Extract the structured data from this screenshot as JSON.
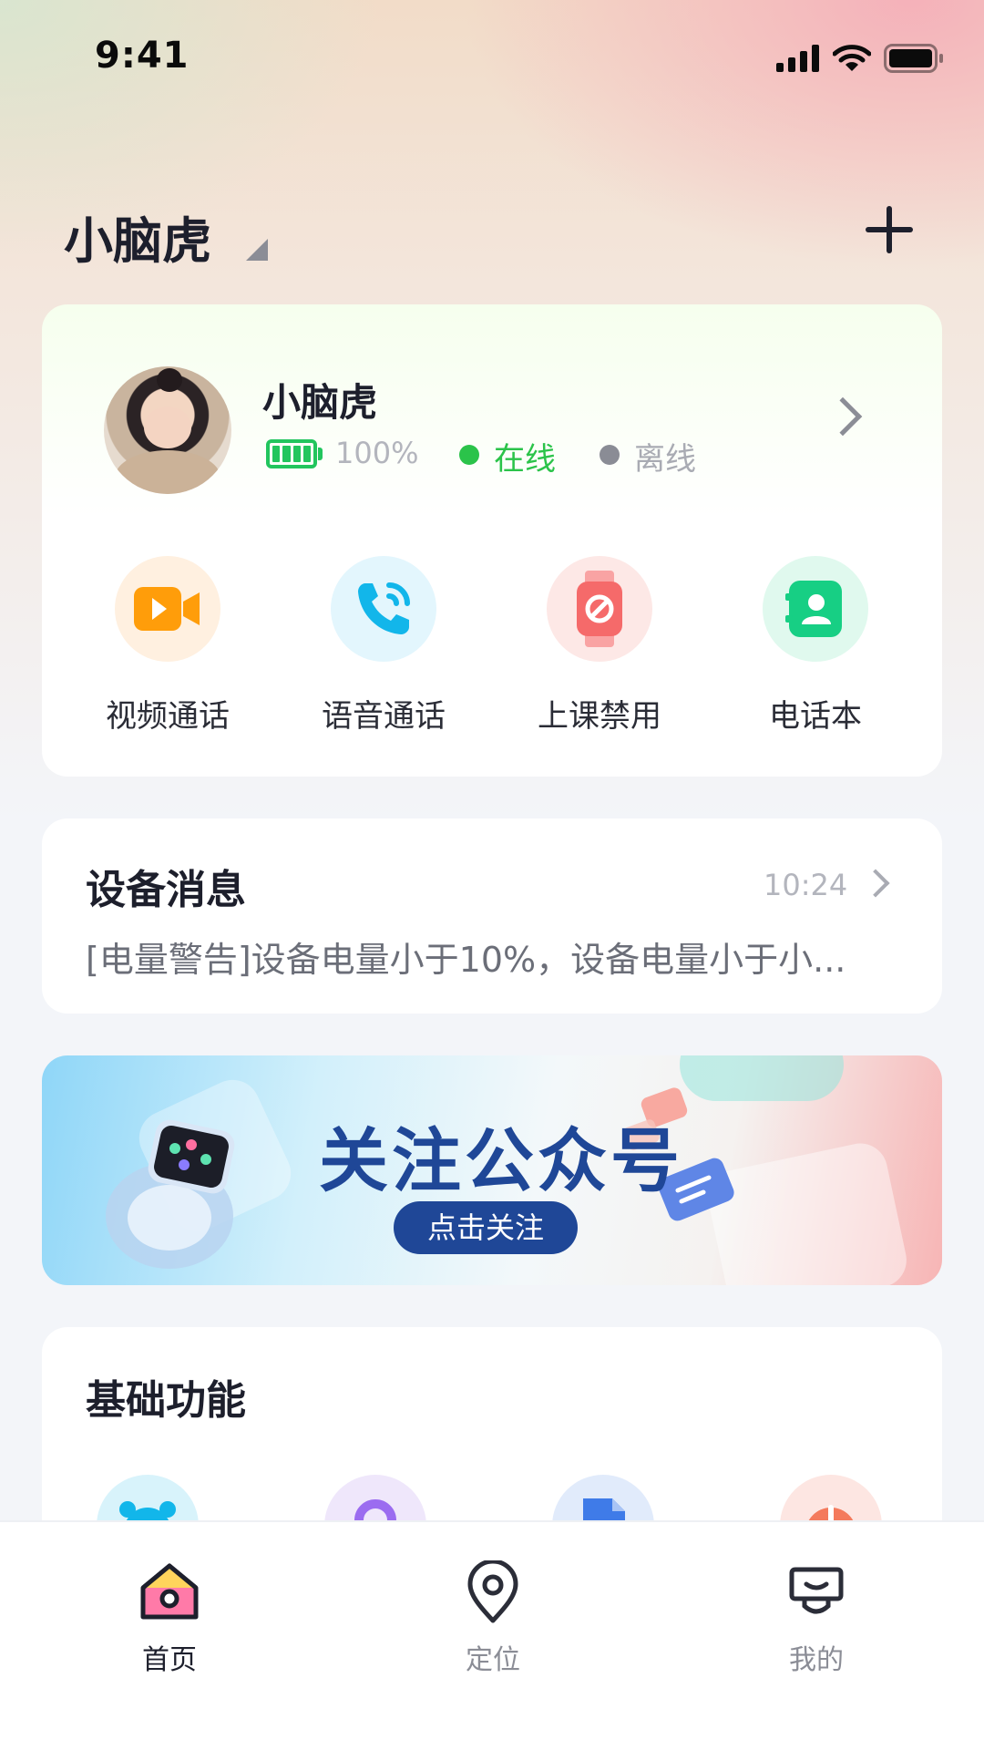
{
  "status_bar": {
    "time": "9:41"
  },
  "header": {
    "device_name": "小脑虎"
  },
  "profile": {
    "name": "小脑虎",
    "battery": "100%",
    "battery_level": 1.0,
    "online": "在线",
    "offline": "离线"
  },
  "actions": [
    {
      "label": "视频通话",
      "icon": "video-icon",
      "bg": "#fff0e0",
      "color": "#ff9d0a"
    },
    {
      "label": "语音通话",
      "icon": "phone-call-icon",
      "bg": "#e3f6fd",
      "color": "#12b6ea"
    },
    {
      "label": "上课禁用",
      "icon": "watch-ban-icon",
      "bg": "#fde8e6",
      "color": "#f56a6a"
    },
    {
      "label": "电话本",
      "icon": "contacts-icon",
      "bg": "#e0f9ee",
      "color": "#17cf84"
    }
  ],
  "message": {
    "title": "设备消息",
    "time": "10:24",
    "body": "[电量警告]设备电量小于10%，设备电量小于小..."
  },
  "banner": {
    "title": "关注公众号",
    "button": "点击关注"
  },
  "basic_functions": {
    "title": "基础功能",
    "icons": [
      "alarm-icon",
      "location-pin-icon",
      "file-icon",
      "power-icon"
    ],
    "colors": [
      "#d8f3fb",
      "#efe7fb",
      "#e1ebfb",
      "#fde6e2"
    ]
  },
  "tabbar": {
    "tabs": [
      {
        "label": "首页",
        "icon": "home-icon",
        "active": true
      },
      {
        "label": "定位",
        "icon": "location-icon",
        "active": false
      },
      {
        "label": "我的",
        "icon": "profile-icon",
        "active": false
      }
    ]
  }
}
